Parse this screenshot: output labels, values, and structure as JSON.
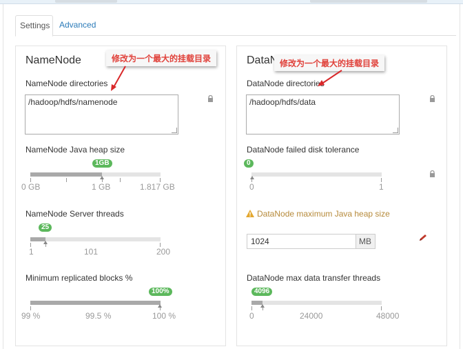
{
  "tabs": {
    "settings": "Settings",
    "advanced": "Advanced"
  },
  "namenode": {
    "title": "NameNode",
    "dirs_label": "NameNode directories",
    "dirs_value": "/hadoop/hdfs/namenode",
    "heap_label": "NameNode Java heap size",
    "heap_badge": "1GB",
    "heap_ticks": [
      "0 GB",
      "1 GB",
      "1.817 GB"
    ],
    "heap_fraction": 0.55,
    "threads_label": "NameNode Server threads",
    "threads_badge": "25",
    "threads_ticks": [
      "1",
      "101",
      "200"
    ],
    "threads_fraction": 0.12,
    "minrep_label": "Minimum replicated blocks %",
    "minrep_badge": "100%",
    "minrep_ticks": [
      "99 %",
      "99.5 %",
      "100 %"
    ],
    "minrep_fraction": 1.0
  },
  "datanode": {
    "title": "DataNode",
    "dirs_label": "DataNode directories",
    "dirs_value": "/hadoop/hdfs/data",
    "failed_label": "DataNode failed disk tolerance",
    "failed_badge": "0",
    "failed_ticks": [
      "0",
      "1"
    ],
    "failed_fraction": 0.0,
    "heap_warning_label": "DataNode maximum Java heap size",
    "heap_value": "1024",
    "heap_unit": "MB",
    "transfer_label": "DataNode max data transfer threads",
    "transfer_badge": "4096",
    "transfer_ticks": [
      "0",
      "24000",
      "48000"
    ],
    "transfer_fraction": 0.085
  },
  "annotations": {
    "namenode_note": "修改为一个最大的挂载目录",
    "datanode_note": "修改为一个最大的挂载目录"
  },
  "colors": {
    "badge": "#5cb85c",
    "annotation": "#e0413a",
    "warning": "#b68a3a",
    "link": "#2a7ab8"
  }
}
